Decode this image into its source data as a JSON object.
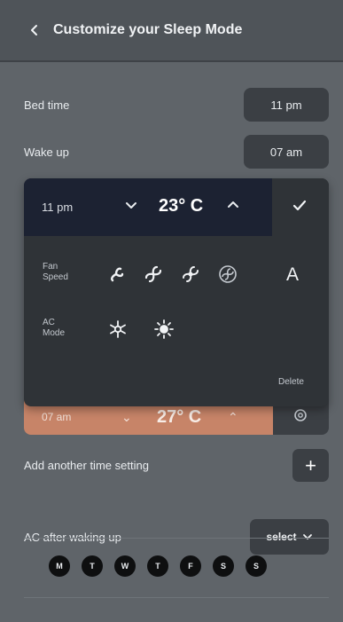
{
  "header": {
    "title": "Customize your Sleep Mode"
  },
  "bed_time": {
    "label": "Bed time",
    "value": "11 pm"
  },
  "wake_up": {
    "label": "Wake up",
    "value": "07 am"
  },
  "editor": {
    "time": "11 pm",
    "temperature": "23° C",
    "fan_speed_label_1": "Fan",
    "fan_speed_label_2": "Speed",
    "fan_auto": "A",
    "ac_mode_label_1": "AC",
    "ac_mode_label_2": "Mode",
    "delete_label": "Delete",
    "icons": [
      "chevron-down-icon",
      "chevron-up-icon",
      "check-icon",
      "fan-low-icon",
      "fan-medium-icon",
      "fan-high-icon",
      "fan-turbo-icon",
      "snowflake-icon",
      "sun-icon"
    ]
  },
  "second_setting": {
    "time": "07 am",
    "temperature": "27° C"
  },
  "add_time": {
    "label": "Add another time setting",
    "button": "+"
  },
  "ac_after": {
    "label": "AC after waking up",
    "select_label": "select"
  },
  "days": [
    "M",
    "T",
    "W",
    "T",
    "F",
    "S",
    "S"
  ],
  "colors": {
    "background": "#5f6469",
    "card": "#2f3337",
    "accent": "#c78468",
    "navy": "#1c2232"
  }
}
